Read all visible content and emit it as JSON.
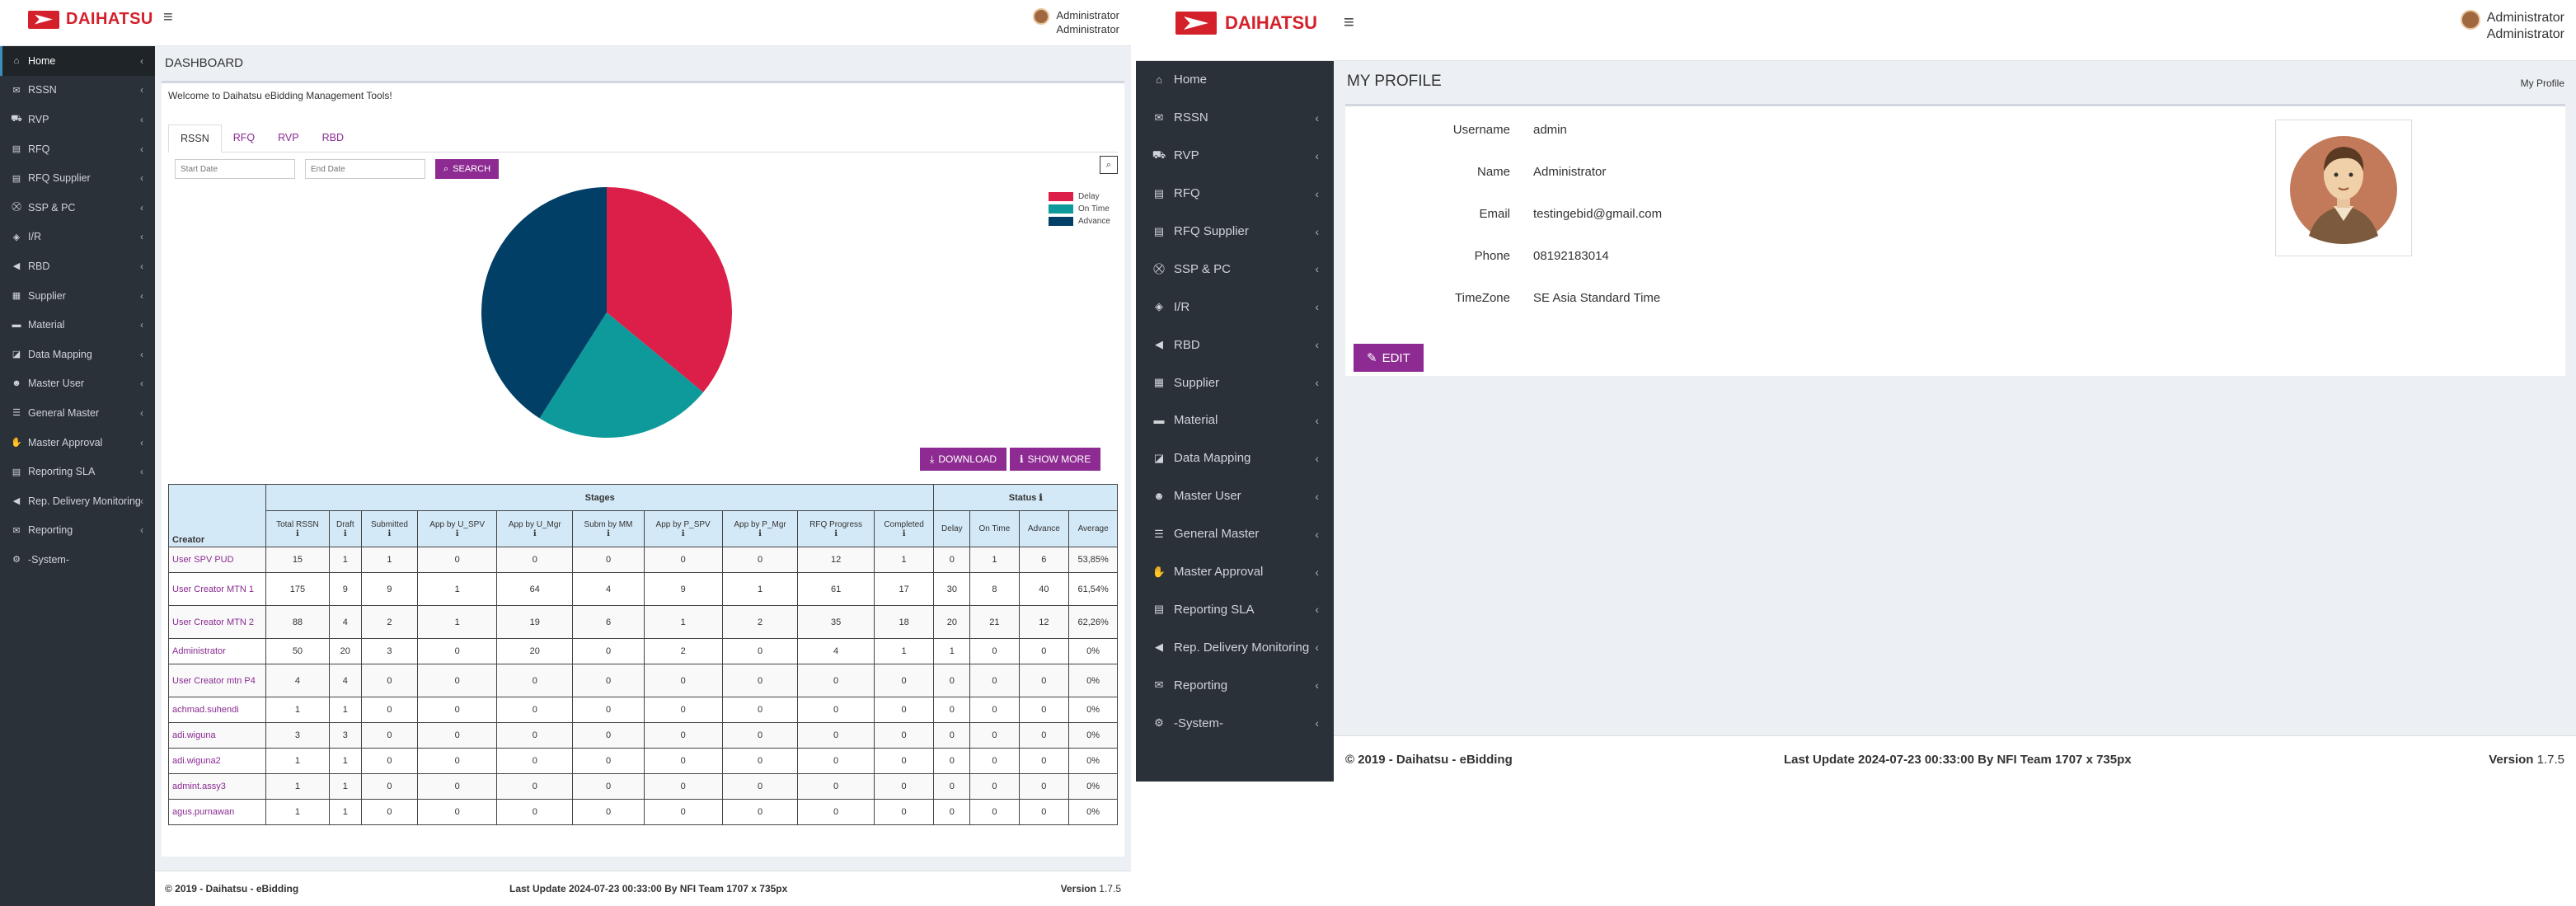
{
  "left": {
    "logo": "DAIHATSU",
    "hamburger": "≡",
    "user": {
      "line1": "Administrator",
      "line2": "Administrator"
    },
    "sidebar": [
      {
        "label": "Home",
        "icon": "home-icon",
        "glyph": "⌂",
        "active": true
      },
      {
        "label": "RSSN",
        "icon": "envelope-icon",
        "glyph": "✉"
      },
      {
        "label": "RVP",
        "icon": "truck-icon",
        "glyph": "⛟"
      },
      {
        "label": "RFQ",
        "icon": "document-icon",
        "glyph": "▤"
      },
      {
        "label": "RFQ Supplier",
        "icon": "document-icon",
        "glyph": "▤"
      },
      {
        "label": "SSP & PC",
        "icon": "cart-icon",
        "glyph": "⛒"
      },
      {
        "label": "I/R",
        "icon": "tag-icon",
        "glyph": "◈"
      },
      {
        "label": "RBD",
        "icon": "megaphone-icon",
        "glyph": "◀"
      },
      {
        "label": "Supplier",
        "icon": "building-icon",
        "glyph": "▦"
      },
      {
        "label": "Material",
        "icon": "briefcase-icon",
        "glyph": "▬"
      },
      {
        "label": "Data Mapping",
        "icon": "map-icon",
        "glyph": "◪"
      },
      {
        "label": "Master User",
        "icon": "users-icon",
        "glyph": "☻"
      },
      {
        "label": "General Master",
        "icon": "list-icon",
        "glyph": "☰"
      },
      {
        "label": "Master Approval",
        "icon": "handshake-icon",
        "glyph": "✋"
      },
      {
        "label": "Reporting SLA",
        "icon": "report-icon",
        "glyph": "▤"
      },
      {
        "label": "Rep. Delivery Monitoring",
        "icon": "megaphone-icon",
        "glyph": "◀"
      },
      {
        "label": "Reporting",
        "icon": "inbox-icon",
        "glyph": "✉"
      },
      {
        "label": "-System-",
        "icon": "gear-icon",
        "glyph": "⚙",
        "nochev": true
      }
    ],
    "page_title": "DASHBOARD",
    "welcome": "Welcome to Daihatsu eBidding Management Tools!",
    "tabs": [
      "RSSN",
      "RFQ",
      "RVP",
      "RBD"
    ],
    "start_placeholder": "Start Date",
    "end_placeholder": "End Date",
    "search_label": "SEARCH",
    "download_label": "DOWNLOAD",
    "showmore_label": "SHOW MORE",
    "chart_data": {
      "type": "pie",
      "legend_position": "top-right",
      "labels": [
        "Delay",
        "On Time",
        "Advance"
      ],
      "values": [
        36,
        23,
        41
      ],
      "colors": [
        "#dc1f48",
        "#0e9a9b",
        "#023f66"
      ]
    },
    "table": {
      "creator_header": "Creator",
      "stages_header": "Stages",
      "status_header": "Status",
      "stage_cols": [
        "Total RSSN",
        "Draft",
        "Submitted",
        "App by U_SPV",
        "App by U_Mgr",
        "Subm by MM",
        "App by P_SPV",
        "App by P_Mgr",
        "RFQ Progress",
        "Completed"
      ],
      "status_cols": [
        "Delay",
        "On Time",
        "Advance",
        "Average"
      ],
      "rows": [
        [
          "User SPV PUD",
          "15",
          "1",
          "1",
          "0",
          "0",
          "0",
          "0",
          "0",
          "12",
          "1",
          "0",
          "1",
          "6",
          "53,85%"
        ],
        [
          "User Creator MTN 1",
          "175",
          "9",
          "9",
          "1",
          "64",
          "4",
          "9",
          "1",
          "61",
          "17",
          "30",
          "8",
          "40",
          "61,54%"
        ],
        [
          "User Creator MTN 2",
          "88",
          "4",
          "2",
          "1",
          "19",
          "6",
          "1",
          "2",
          "35",
          "18",
          "20",
          "21",
          "12",
          "62,26%"
        ],
        [
          "Administrator",
          "50",
          "20",
          "3",
          "0",
          "20",
          "0",
          "2",
          "0",
          "4",
          "1",
          "1",
          "0",
          "0",
          "0%"
        ],
        [
          "User Creator mtn P4",
          "4",
          "4",
          "0",
          "0",
          "0",
          "0",
          "0",
          "0",
          "0",
          "0",
          "0",
          "0",
          "0",
          "0%"
        ],
        [
          "achmad.suhendi",
          "1",
          "1",
          "0",
          "0",
          "0",
          "0",
          "0",
          "0",
          "0",
          "0",
          "0",
          "0",
          "0",
          "0%"
        ],
        [
          "adi.wiguna",
          "3",
          "3",
          "0",
          "0",
          "0",
          "0",
          "0",
          "0",
          "0",
          "0",
          "0",
          "0",
          "0",
          "0%"
        ],
        [
          "adi.wiguna2",
          "1",
          "1",
          "0",
          "0",
          "0",
          "0",
          "0",
          "0",
          "0",
          "0",
          "0",
          "0",
          "0",
          "0%"
        ],
        [
          "admint.assy3",
          "1",
          "1",
          "0",
          "0",
          "0",
          "0",
          "0",
          "0",
          "0",
          "0",
          "0",
          "0",
          "0",
          "0%"
        ],
        [
          "agus.purnawan",
          "1",
          "1",
          "0",
          "0",
          "0",
          "0",
          "0",
          "0",
          "0",
          "0",
          "0",
          "0",
          "0",
          "0%"
        ]
      ]
    },
    "footer": {
      "copyright": "© 2019 - Daihatsu - eBidding",
      "update": "Last Update 2024-07-23 00:33:00 By NFI Team 1707 x 735px",
      "version_label": "Version",
      "version": "1.7.5"
    }
  },
  "right": {
    "logo": "DAIHATSU",
    "hamburger": "≡",
    "user": {
      "line1": "Administrator",
      "line2": "Administrator"
    },
    "sidebar": [
      {
        "label": "Home",
        "icon": "home-icon",
        "glyph": "⌂",
        "nochev": true
      },
      {
        "label": "RSSN",
        "icon": "envelope-icon",
        "glyph": "✉"
      },
      {
        "label": "RVP",
        "icon": "truck-icon",
        "glyph": "⛟"
      },
      {
        "label": "RFQ",
        "icon": "document-icon",
        "glyph": "▤"
      },
      {
        "label": "RFQ Supplier",
        "icon": "document-icon",
        "glyph": "▤"
      },
      {
        "label": "SSP & PC",
        "icon": "cart-icon",
        "glyph": "⛒"
      },
      {
        "label": "I/R",
        "icon": "tag-icon",
        "glyph": "◈"
      },
      {
        "label": "RBD",
        "icon": "megaphone-icon",
        "glyph": "◀"
      },
      {
        "label": "Supplier",
        "icon": "building-icon",
        "glyph": "▦"
      },
      {
        "label": "Material",
        "icon": "briefcase-icon",
        "glyph": "▬"
      },
      {
        "label": "Data Mapping",
        "icon": "map-icon",
        "glyph": "◪"
      },
      {
        "label": "Master User",
        "icon": "users-icon",
        "glyph": "☻"
      },
      {
        "label": "General Master",
        "icon": "list-icon",
        "glyph": "☰"
      },
      {
        "label": "Master Approval",
        "icon": "handshake-icon",
        "glyph": "✋"
      },
      {
        "label": "Reporting SLA",
        "icon": "report-icon",
        "glyph": "▤"
      },
      {
        "label": "Rep. Delivery Monitoring",
        "icon": "megaphone-icon",
        "glyph": "◀"
      },
      {
        "label": "Reporting",
        "icon": "inbox-icon",
        "glyph": "✉"
      },
      {
        "label": "-System-",
        "icon": "gear-icon",
        "glyph": "⚙"
      }
    ],
    "page_title": "MY PROFILE",
    "breadcrumb": "My Profile",
    "profile": [
      {
        "label": "Username",
        "value": "admin"
      },
      {
        "label": "Name",
        "value": "Administrator"
      },
      {
        "label": "Email",
        "value": "testingebid@gmail.com"
      },
      {
        "label": "Phone",
        "value": "08192183014"
      },
      {
        "label": "TimeZone",
        "value": "SE Asia Standard Time"
      }
    ],
    "edit_label": "EDIT",
    "footer": {
      "copyright": "© 2019 - Daihatsu - eBidding",
      "update": "Last Update 2024-07-23 00:33:00 By NFI Team 1707 x 735px",
      "version_label": "Version",
      "version": "1.7.5"
    }
  }
}
